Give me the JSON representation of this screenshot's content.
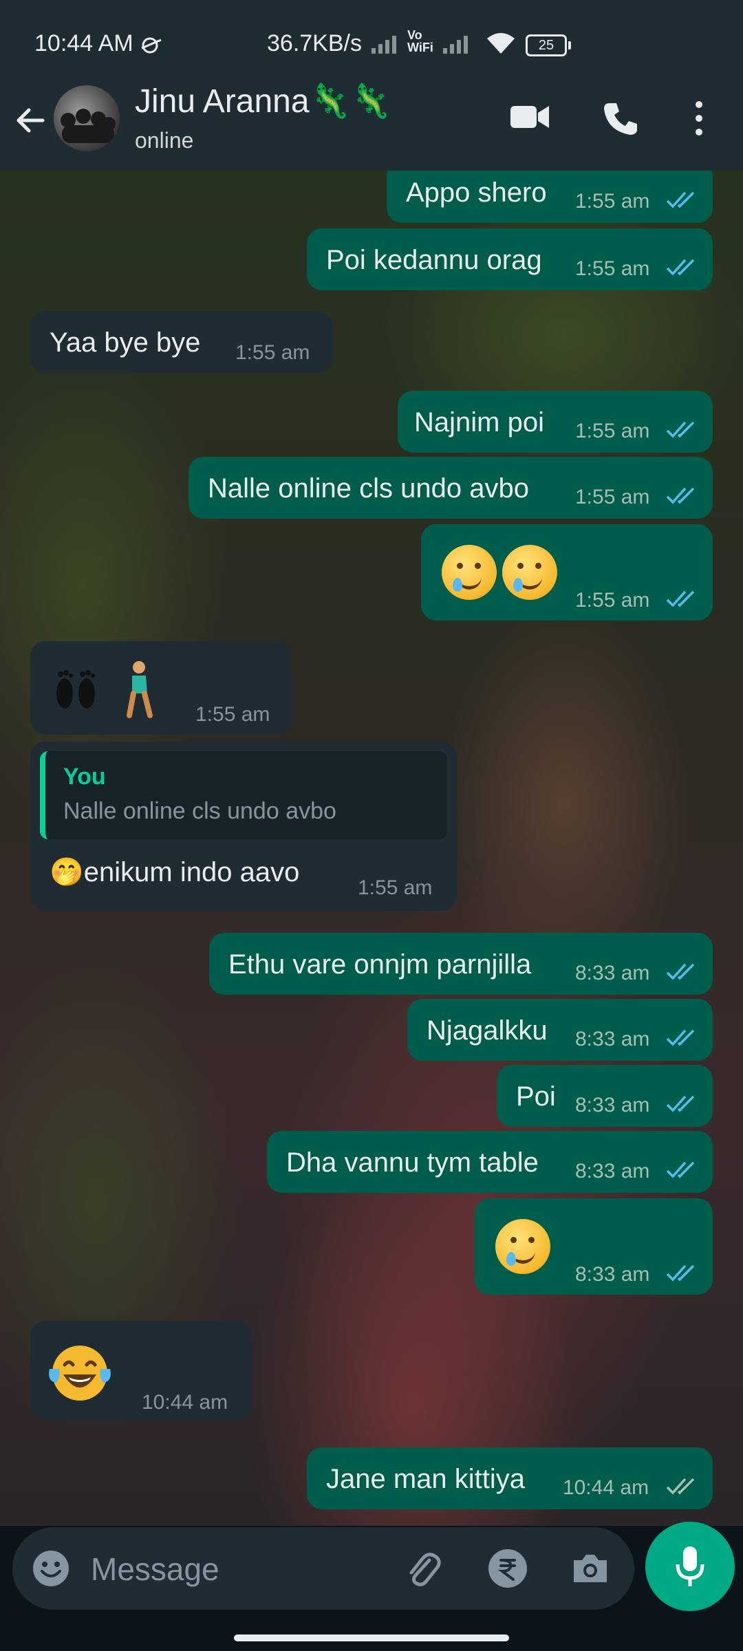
{
  "status_bar": {
    "time": "10:44 AM",
    "net_speed": "36.7KB/s",
    "vowifi": "Vo\nWiFi",
    "battery": "25"
  },
  "header": {
    "contact_name": "Jinu Aranna🦎🦎",
    "status": "online"
  },
  "messages": [
    {
      "dir": "out",
      "text": "Appo shero",
      "time": "1:55 am",
      "ticks": "read"
    },
    {
      "dir": "out",
      "text": "Poi kedannu orag",
      "time": "1:55 am",
      "ticks": "read"
    },
    {
      "dir": "in",
      "text": "Yaa bye bye",
      "time": "1:55 am"
    },
    {
      "dir": "out",
      "text": "Najnim poi",
      "time": "1:55 am",
      "ticks": "read"
    },
    {
      "dir": "out",
      "text": "Nalle online cls undo avbo",
      "time": "1:55 am",
      "ticks": "read"
    },
    {
      "dir": "out",
      "text": "",
      "emoji": "face-holding-back-tears x2",
      "time": "1:55 am",
      "ticks": "read"
    },
    {
      "dir": "in",
      "text": "👣🚶",
      "time": "1:55 am"
    },
    {
      "dir": "in",
      "reply_to": {
        "author": "You",
        "text": "Nalle online cls undo avbo"
      },
      "text": "🤭enikum indo aavo",
      "time": "1:55 am"
    },
    {
      "dir": "out",
      "text": "Ethu vare onnjm parnjilla",
      "time": "8:33 am",
      "ticks": "read"
    },
    {
      "dir": "out",
      "text": "Njagalkku",
      "time": "8:33 am",
      "ticks": "read"
    },
    {
      "dir": "out",
      "text": "Poi",
      "time": "8:33 am",
      "ticks": "read"
    },
    {
      "dir": "out",
      "text": "Dha vannu tym table",
      "time": "8:33 am",
      "ticks": "read"
    },
    {
      "dir": "out",
      "text": "",
      "emoji": "face-holding-back-tears",
      "time": "8:33 am",
      "ticks": "read"
    },
    {
      "dir": "in",
      "text": "😂",
      "time": "10:44 am"
    },
    {
      "dir": "out",
      "text": "Jane man kittiya",
      "time": "10:44 am",
      "ticks": "delivered"
    }
  ],
  "input": {
    "placeholder": "Message"
  },
  "colors": {
    "outgoing_bubble": "#005c4b",
    "incoming_bubble": "#1f2c34",
    "header": "#1f2c34",
    "accent": "#00a884",
    "read_tick": "#53bdeb"
  },
  "icons": [
    "back-arrow-icon",
    "video-call-icon",
    "phone-icon",
    "more-options-icon",
    "emoji-icon",
    "attach-icon",
    "rupee-payment-icon",
    "camera-icon",
    "mic-icon"
  ]
}
